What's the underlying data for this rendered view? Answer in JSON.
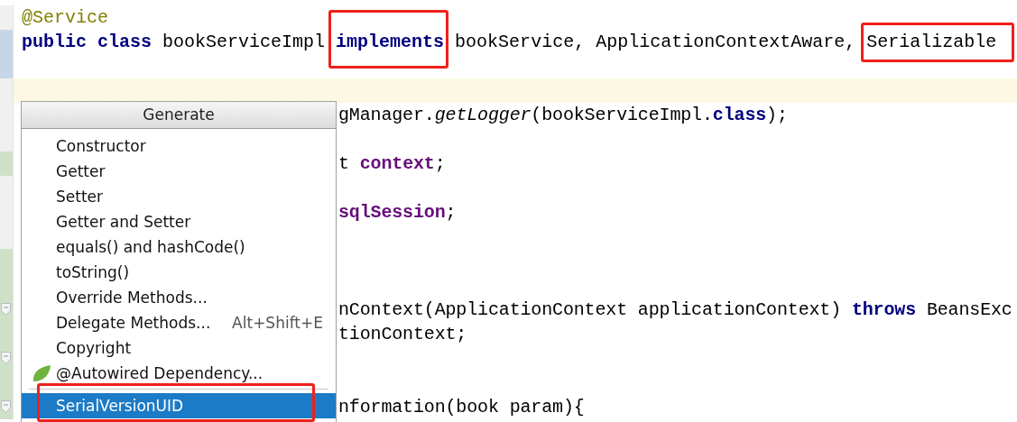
{
  "editor": {
    "lines": [
      {
        "kind": "full",
        "modified": false,
        "added": false,
        "current": false,
        "fold": false,
        "tokens": [
          {
            "kind": "annotation",
            "text": "@Service"
          }
        ]
      },
      {
        "kind": "full",
        "modified": true,
        "added": false,
        "current": false,
        "fold": false,
        "tokens": [
          {
            "kind": "keyword",
            "text": "public class"
          },
          {
            "kind": "plain",
            "text": " bookServiceImpl "
          },
          {
            "kind": "keyword",
            "text": "implements"
          },
          {
            "kind": "plain",
            "text": " bookService, ApplicationContextAware, Serializable"
          }
        ]
      },
      {
        "kind": "full",
        "modified": true,
        "added": false,
        "current": false,
        "fold": false
      },
      {
        "modified": false,
        "added": false,
        "current": true,
        "fold": false
      },
      {
        "kind": "partial",
        "modified": false,
        "added": false,
        "current": false,
        "fold": false,
        "tokens": [
          {
            "kind": "plain",
            "text": "gManager."
          },
          {
            "kind": "method",
            "text": "getLogger"
          },
          {
            "kind": "plain",
            "text": "(bookServiceImpl."
          },
          {
            "kind": "keyword",
            "text": "class"
          },
          {
            "kind": "plain",
            "text": ");"
          }
        ]
      },
      {
        "kind": "full",
        "modified": false,
        "added": false,
        "current": false,
        "fold": false
      },
      {
        "kind": "partial",
        "modified": false,
        "added": true,
        "current": false,
        "fold": false,
        "tokens": [
          {
            "kind": "plain",
            "text": "t "
          },
          {
            "kind": "field",
            "text": "context"
          },
          {
            "kind": "plain",
            "text": ";"
          }
        ]
      },
      {
        "kind": "full",
        "modified": false,
        "added": false,
        "current": false,
        "fold": false
      },
      {
        "kind": "partial",
        "modified": false,
        "added": false,
        "current": false,
        "fold": false,
        "tokens": [
          {
            "kind": "field",
            "text": "sqlSession"
          },
          {
            "kind": "plain",
            "text": ";"
          }
        ]
      },
      {
        "kind": "full",
        "modified": false,
        "added": false,
        "current": false,
        "fold": false
      },
      {
        "kind": "full",
        "modified": false,
        "added": true,
        "current": false,
        "fold": false
      },
      {
        "kind": "full",
        "modified": false,
        "added": true,
        "current": false,
        "fold": false
      },
      {
        "kind": "partial",
        "modified": false,
        "added": true,
        "current": false,
        "fold": true,
        "tokens": [
          {
            "kind": "plain",
            "text": "nContext(ApplicationContext applicationContext) "
          },
          {
            "kind": "keyword",
            "text": "throws"
          },
          {
            "kind": "plain",
            "text": " BeansExc"
          }
        ]
      },
      {
        "kind": "partial",
        "modified": false,
        "added": true,
        "current": false,
        "fold": false,
        "tokens": [
          {
            "kind": "plain",
            "text": "tionContext;"
          }
        ]
      },
      {
        "kind": "full",
        "modified": false,
        "added": true,
        "current": false,
        "fold": true
      },
      {
        "kind": "full",
        "modified": false,
        "added": true,
        "current": false,
        "fold": false
      },
      {
        "kind": "partial",
        "modified": false,
        "added": true,
        "current": false,
        "fold": true,
        "tokens": [
          {
            "kind": "plain",
            "text": "nformation(book param){"
          }
        ]
      }
    ]
  },
  "popup": {
    "title": "Generate",
    "items": [
      {
        "kind": "item",
        "label": "Constructor",
        "selected": false
      },
      {
        "kind": "item",
        "label": "Getter",
        "selected": false
      },
      {
        "kind": "item",
        "label": "Setter",
        "selected": false
      },
      {
        "kind": "item",
        "label": "Getter and Setter",
        "selected": false
      },
      {
        "kind": "item",
        "label": "equals() and hashCode()",
        "selected": false
      },
      {
        "kind": "item",
        "label": "toString()",
        "selected": false
      },
      {
        "kind": "item",
        "label": "Override Methods...",
        "selected": false
      },
      {
        "kind": "item",
        "label": "Delegate Methods...",
        "shortcut": "Alt+Shift+E",
        "selected": false
      },
      {
        "kind": "item",
        "label": "Copyright",
        "selected": false
      },
      {
        "kind": "leaf-item",
        "label": "@Autowired Dependency...",
        "selected": false
      },
      {
        "kind": "separator"
      },
      {
        "kind": "item",
        "label": "SerialVersionUID",
        "selected": true
      }
    ]
  }
}
